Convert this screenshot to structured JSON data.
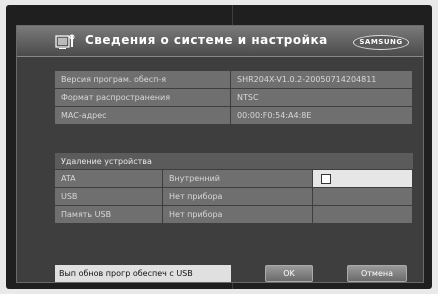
{
  "header": {
    "title": "Сведения о системе и настройка",
    "brand": "SAMSUNG",
    "icon": "settings-tv-icon"
  },
  "info_rows": [
    {
      "label": "Версия програм. обесп-я",
      "value": "SHR204X-V1.0.2-20050714204811"
    },
    {
      "label": "Формат распространения",
      "value": "NTSC"
    },
    {
      "label": "MAC-адрес",
      "value": "00:00:F0:54:A4:8E"
    }
  ],
  "device_removal": {
    "title": "Удаление устройства",
    "rows": [
      {
        "name": "ATA",
        "status": "Внутренний",
        "checked": false
      },
      {
        "name": "USB",
        "status": "Нет прибора"
      },
      {
        "name": "Память USB",
        "status": "Нет прибора"
      }
    ]
  },
  "footer": {
    "update_label": "Вып обнов прогр обеспеч с USB",
    "ok_label": "OK",
    "cancel_label": "Отмена"
  }
}
